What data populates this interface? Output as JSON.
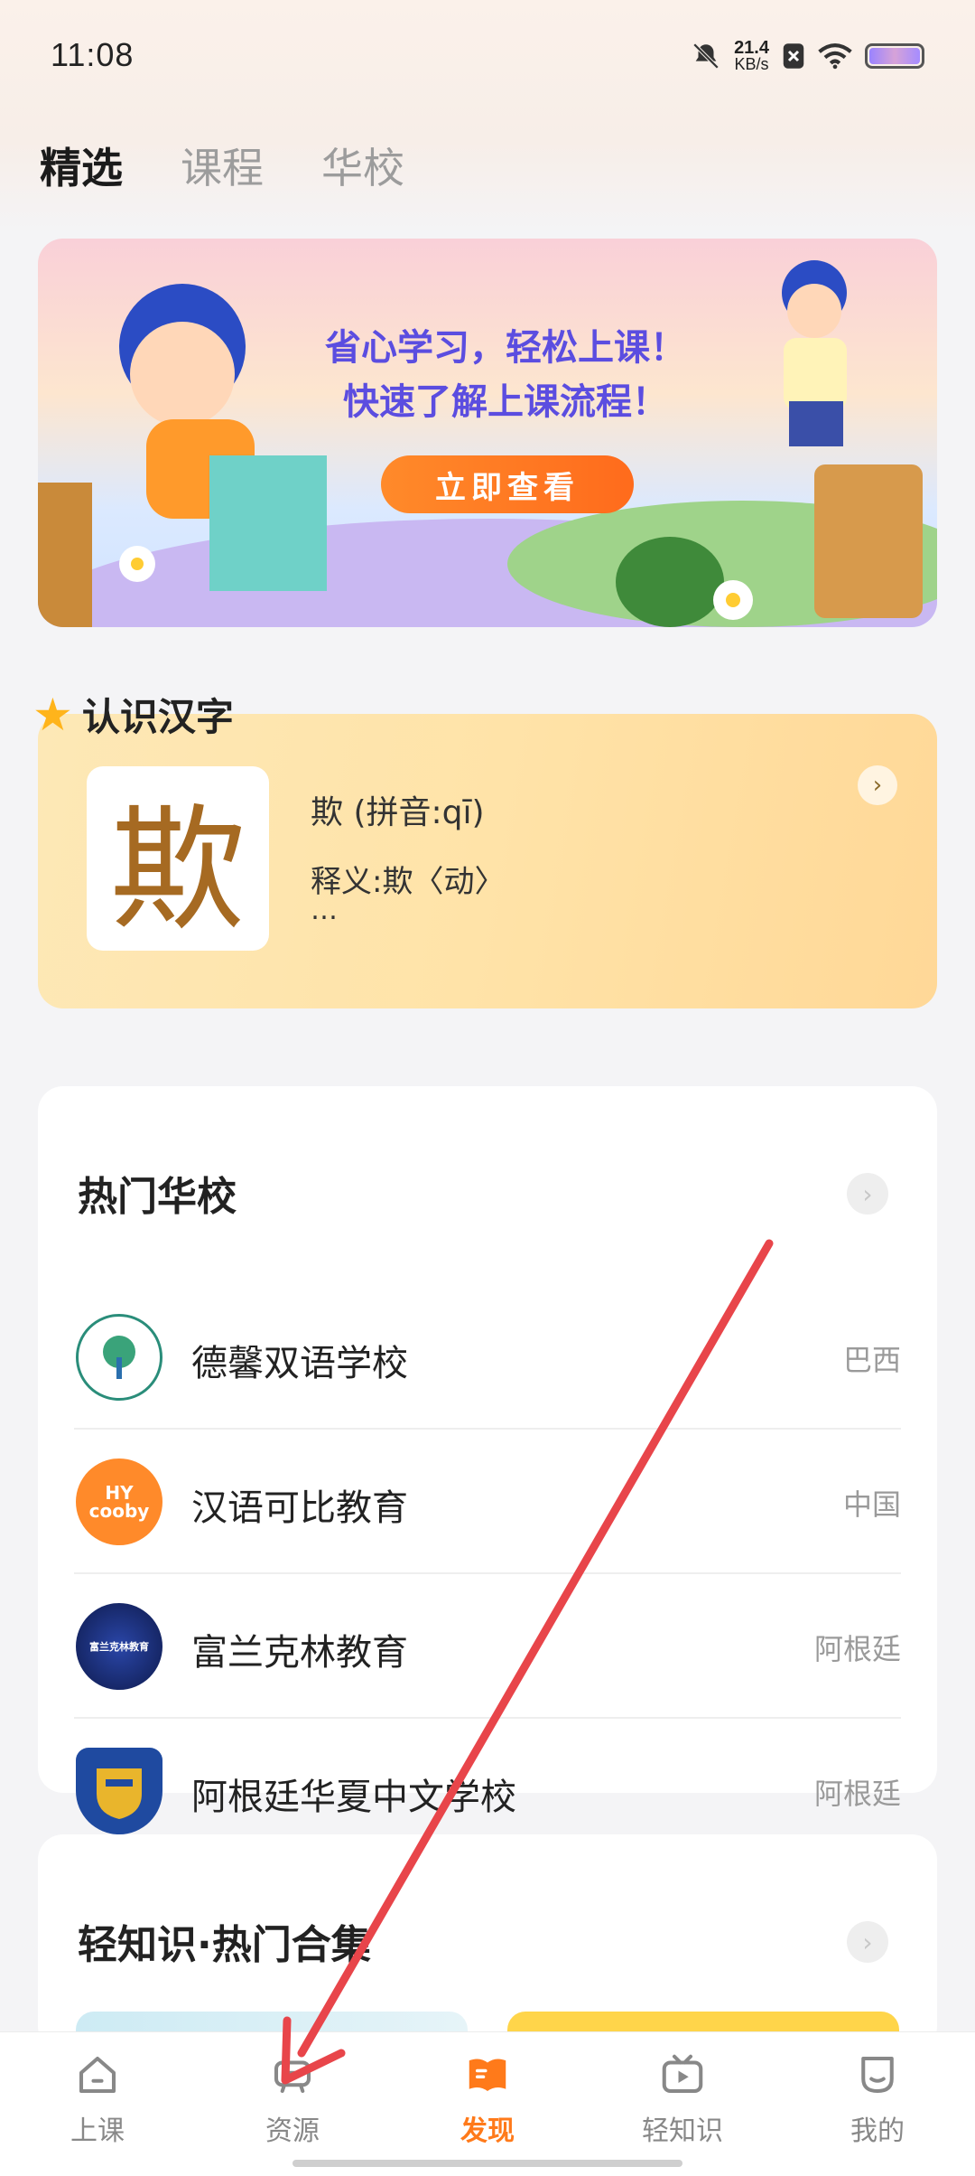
{
  "status_bar": {
    "time": "11:08",
    "speed_value": "21.4",
    "speed_unit": "KB/s"
  },
  "tabs": [
    {
      "label": "精选"
    },
    {
      "label": "课程"
    },
    {
      "label": "华校"
    }
  ],
  "banner": {
    "line1": "省心学习，轻松上课！",
    "line2": "快速了解上课流程！",
    "cta": "立即查看"
  },
  "hanzi_card": {
    "title": "认识汉字",
    "character": "欺",
    "pinyin": "欺 (拼音:qī)",
    "meaning": "释义:欺〈动〉",
    "more": "…"
  },
  "schools": {
    "title": "热门华校",
    "items": [
      {
        "name": "德馨双语学校",
        "country": "巴西",
        "logo_color": "#2a8d7a"
      },
      {
        "name": "汉语可比教育",
        "country": "中国",
        "logo_color": "#ff8a2a",
        "logo_text": "HY cooby"
      },
      {
        "name": "富兰克林教育",
        "country": "阿根廷",
        "logo_color": "#1b2f78",
        "logo_text": "富兰克林教育"
      },
      {
        "name": "阿根廷华夏中文学校",
        "country": "阿根廷",
        "logo_color": "#1f4aa0"
      }
    ]
  },
  "knowledge": {
    "title": "轻知识·热门合集"
  },
  "bottom_nav": [
    {
      "label": "上课",
      "icon": "home-icon"
    },
    {
      "label": "资源",
      "icon": "resource-icon"
    },
    {
      "label": "发现",
      "icon": "discover-book-icon",
      "active": true
    },
    {
      "label": "轻知识",
      "icon": "video-icon"
    },
    {
      "label": "我的",
      "icon": "profile-icon"
    }
  ],
  "colors": {
    "accent": "#ff7a1a",
    "annotation_arrow": "#e8454a"
  }
}
